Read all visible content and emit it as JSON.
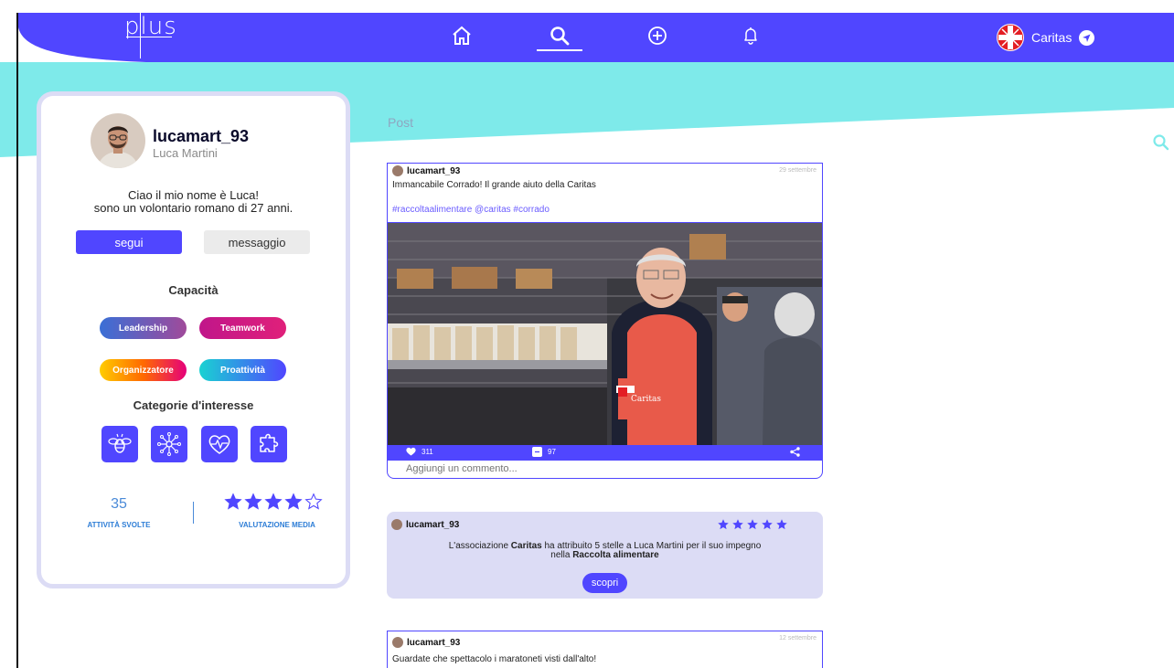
{
  "app": {
    "logo_text": "plus"
  },
  "colors": {
    "primary": "#5046ff",
    "accent_cyan": "#7eeaea",
    "card_border": "#dcdcf5"
  },
  "nav": {
    "items": [
      {
        "name": "home",
        "icon": "home-icon"
      },
      {
        "name": "search",
        "icon": "search-icon",
        "active": true
      },
      {
        "name": "add",
        "icon": "plus-circle-icon"
      },
      {
        "name": "notifications",
        "icon": "bell-icon"
      }
    ],
    "organization": {
      "label": "Caritas",
      "icon": "caritas-logo"
    }
  },
  "profile": {
    "username": "lucamart_93",
    "full_name": "Luca Martini",
    "bio_line1": "Ciao il mio nome è Luca!",
    "bio_line2": "sono un volontario romano di 27 anni.",
    "follow_label": "segui",
    "message_label": "messaggio",
    "skills_title": "Capacità",
    "skills": [
      "Leadership",
      "Teamwork",
      "Organizzatore",
      "Proattività"
    ],
    "interests_title": "Categorie d'interesse",
    "interests": [
      "bee-icon",
      "network-icon",
      "heart-pulse-icon",
      "puzzle-icon"
    ],
    "activities_count": "35",
    "activities_label": "ATTIVITÀ SVOLTE",
    "rating_label": "VALUTAZIONE MEDIA",
    "rating": 4,
    "rating_max": 5
  },
  "feed": {
    "label": "Post",
    "posts": [
      {
        "user": "lucamart_93",
        "date": "29 settembre",
        "text": "Immancabile Corrado! Il grande aiuto della Caritas",
        "tags": "#raccoltaalimentare @caritas #corrado",
        "likes": "311",
        "comments": "97",
        "comment_placeholder": "Aggiungi un commento..."
      }
    ],
    "badge": {
      "user": "lucamart_93",
      "stars": 5,
      "text_pre": "L'associazione ",
      "org": "Caritas",
      "text_mid": " ha attribuito 5 stelle a Luca Martini per il suo impegno",
      "text_line2_pre": "nella ",
      "event": "Raccolta alimentare",
      "button_label": "scopri"
    },
    "post2": {
      "user": "lucamart_93",
      "date": "12 settembre",
      "text": "Guardate che spettacolo i maratoneti visti dall'alto!"
    }
  }
}
